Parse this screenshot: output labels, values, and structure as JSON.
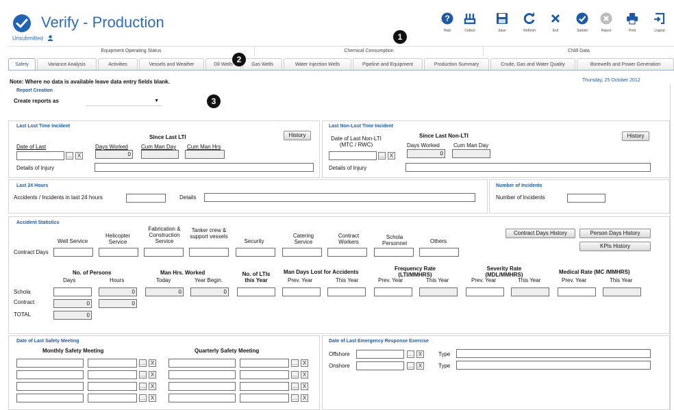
{
  "header": {
    "title": "Verify - Production",
    "status": "Unsubmitted",
    "date": "Thursday, 25 October 2012"
  },
  "toolbar": [
    {
      "label": "Help",
      "icon": "help-icon"
    },
    {
      "label": "Collect",
      "icon": "collect-icon"
    },
    {
      "label": "Save",
      "icon": "save-icon"
    },
    {
      "label": "Refresh",
      "icon": "refresh-icon"
    },
    {
      "label": "Exit",
      "icon": "exit-icon"
    },
    {
      "label": "Submit",
      "icon": "submit-icon"
    },
    {
      "label": "Reject",
      "icon": "reject-icon"
    },
    {
      "label": "Print",
      "icon": "print-icon"
    },
    {
      "label": "Logout",
      "icon": "logout-icon"
    }
  ],
  "categories": [
    "Equipment Operating Status",
    "Chemical Consumption",
    "Chlill Data"
  ],
  "tabs": [
    "Safety",
    "Variance Analysis",
    "Activities",
    "Vessels and Weather",
    "Oil Wells",
    "Gas Wells",
    "Water Injection Wells",
    "Pipeline and Equipment",
    "Production Summary",
    "Crude, Gas and Water Quality",
    "Borewells and Power Generation"
  ],
  "badges": [
    "1",
    "2",
    "3"
  ],
  "note": "Note: Where no data is available leave data entry fields blank.",
  "report_creation": {
    "heading": "Report Creation",
    "label": "Create reports as"
  },
  "last_lti": {
    "heading": "Last Lost Time Incident",
    "since": "Since Last LTI",
    "history": "History",
    "date_of_last": "Date of Last",
    "days_worked": "Days Worked",
    "cum_man_day": "Cum Man Day",
    "cum_man_hrs": "Cum Man Hrs",
    "days_worked_value": "0",
    "details": "Details of Injury"
  },
  "last_non_lti": {
    "heading": "Last Non-Lost Time Incident",
    "since": "Since Last Non-LTI",
    "history": "History",
    "date_of_last": "Date of Last Non-LTI (MTC / RWC)",
    "days_worked": "Days Worked",
    "cum_man_day": "Cum Man Day",
    "days_worked_value": "0",
    "details": "Details of Injury"
  },
  "last24": {
    "heading": "Last 24 Hours",
    "accidents": "Accidents / Incidents in last 24 hours",
    "details": "Details"
  },
  "incidents": {
    "heading": "Number of Incidents",
    "label": "Number of Incidents"
  },
  "accident_stats": {
    "heading": "Accident Statistics",
    "columns": [
      "Well Service",
      "Helicopter Service",
      "Fabrication & Construction Service",
      "Tanker crew & support vessels",
      "Security",
      "Catering Service",
      "Contract Workers",
      "Schola Personnel",
      "Others"
    ],
    "contract_days": "Contract Days",
    "buttons": [
      "Contract Days History",
      "Person Days History",
      "KPIs History"
    ]
  },
  "persons": {
    "no_of_persons": "No. of Persons",
    "days": "Days",
    "hours": "Hours",
    "man_hrs": "Man Hrs. Worked",
    "today": "Today",
    "year_begin": "Year Begin.",
    "no_ltis": "No. of LTIs this Year",
    "man_days_lost": "Man Days Lost for Accidents",
    "prev_year": "Prev. Year",
    "this_year": "This Year",
    "freq_rate": "Frequency Rate (LTI/MMHRS)",
    "sev_rate": "Severity Rate (MDL/MMHRS)",
    "med_rate": "Medical Rate (MC /MMHRS)",
    "rows": [
      "Schola",
      "Contract",
      "TOTAL"
    ],
    "zero": "0"
  },
  "safety_meeting": {
    "heading": "Date of Last Safety Meeting",
    "monthly": "Monthly Safety Meeting",
    "quarterly": "Quarterly Safety Meeting"
  },
  "emergency": {
    "heading": "Date of Last Emergency Response Exercise",
    "offshore": "Offshore",
    "onshore": "Onshore",
    "type": "Type"
  }
}
